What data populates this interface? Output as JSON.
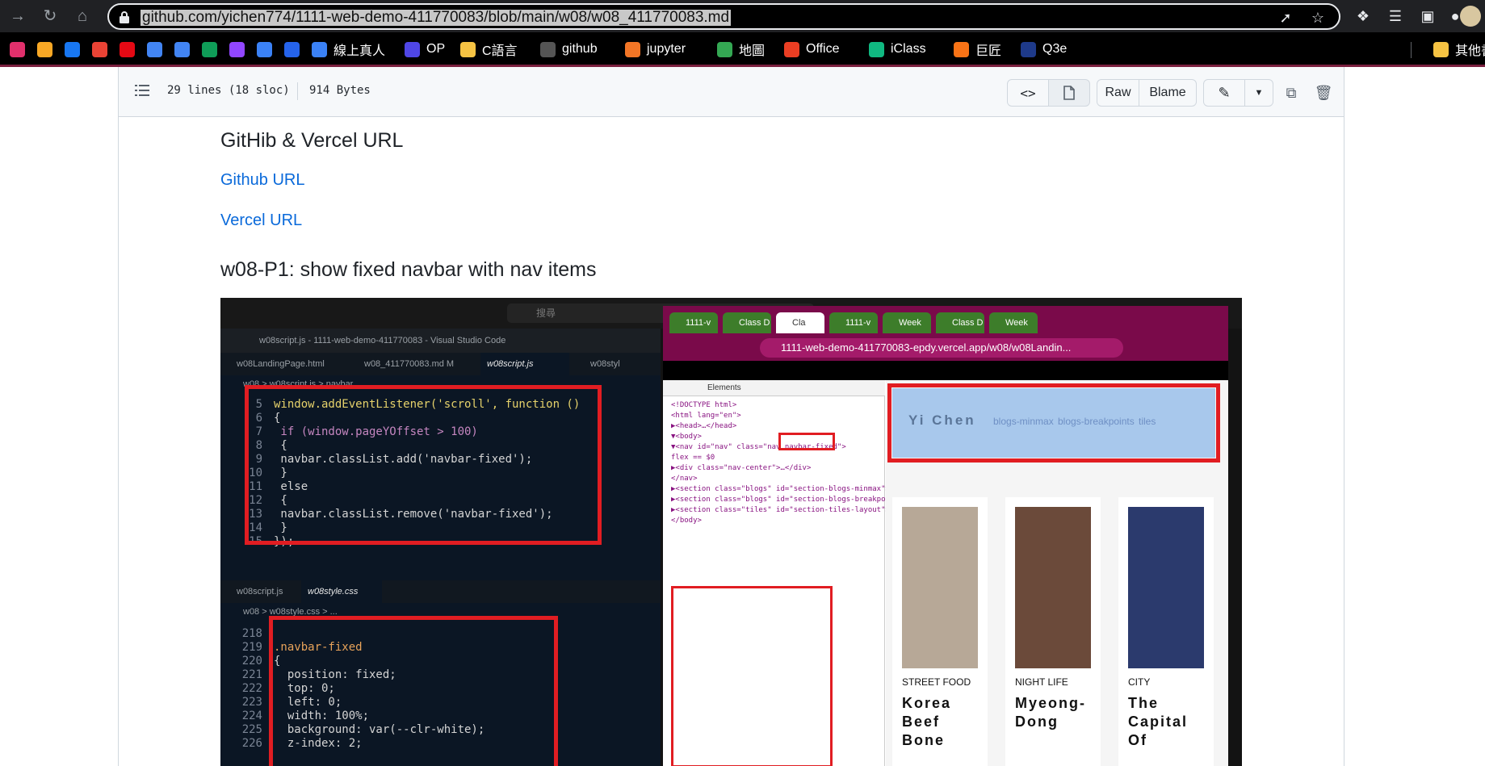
{
  "browser": {
    "url": "github.com/yichen774/1111-web-demo-411770083/blob/main/w08/w08_411770083.md",
    "bookmarks": [
      {
        "label": "",
        "icon": "instagram-icon",
        "color": "#e1306c"
      },
      {
        "label": "",
        "icon": "infinity-icon",
        "color": "#f9a825"
      },
      {
        "label": "",
        "icon": "facebook-icon",
        "color": "#1877f2"
      },
      {
        "label": "",
        "icon": "gmail-icon",
        "color": "#ea4335"
      },
      {
        "label": "",
        "icon": "netflix-icon",
        "color": "#e50914"
      },
      {
        "label": "",
        "icon": "docs-icon",
        "color": "#4285f4"
      },
      {
        "label": "",
        "icon": "translate-icon",
        "color": "#4285f4"
      },
      {
        "label": "",
        "icon": "drive-icon",
        "color": "#0f9d58"
      },
      {
        "label": "",
        "icon": "twitch-icon",
        "color": "#9146ff"
      },
      {
        "label": "",
        "icon": "app-icon",
        "color": "#3b82f6"
      },
      {
        "label": "",
        "icon": "dragon-icon",
        "color": "#2563eb"
      },
      {
        "label": "線上真人",
        "icon": "cloud-icon",
        "color": "#3b82f6"
      },
      {
        "label": "OP",
        "icon": "op-icon",
        "color": "#4f46e5"
      },
      {
        "label": "C語言",
        "icon": "folder-icon",
        "color": "#f6c343"
      },
      {
        "label": "github",
        "icon": "github-icon",
        "color": "#555555"
      },
      {
        "label": "jupyter",
        "icon": "jupyter-icon",
        "color": "#f37626"
      },
      {
        "label": "地圖",
        "icon": "maps-icon",
        "color": "#34a853"
      },
      {
        "label": "Office",
        "icon": "office-icon",
        "color": "#ea3e23"
      },
      {
        "label": "iClass",
        "icon": "iclass-icon",
        "color": "#10b981"
      },
      {
        "label": "巨匠",
        "icon": "jujiang-icon",
        "color": "#f97316"
      },
      {
        "label": "Q3e",
        "icon": "q3e-icon",
        "color": "#1e3a8a"
      }
    ],
    "other_bookmarks": "其他書"
  },
  "file_header": {
    "lines": "29 lines (18 sloc)",
    "size": "914 Bytes",
    "raw": "Raw",
    "blame": "Blame"
  },
  "markdown": {
    "h_urls": "GitHib & Vercel URL",
    "link_github": "Github URL",
    "link_vercel": "Vercel URL",
    "h_p1": "w08-P1: show fixed navbar with nav items"
  },
  "screenshot": {
    "search": "搜尋",
    "vs_title": "w08script.js - 1111-web-demo-411770083 - Visual Studio Code",
    "vs_tabs": [
      "w08LandingPage.html",
      "w08_411770083.md  M",
      "w08script.js",
      "w08styl"
    ],
    "vs_crumb": "w08 > w08script.js > navbar",
    "code1": [
      {
        "n": "5",
        "t": "window.addEventListener('scroll', function ()"
      },
      {
        "n": "6",
        "t": "{"
      },
      {
        "n": "7",
        "t": " if (window.pageYOffset > 100)"
      },
      {
        "n": "8",
        "t": " {"
      },
      {
        "n": "9",
        "t": " navbar.classList.add('navbar-fixed');"
      },
      {
        "n": "10",
        "t": " }"
      },
      {
        "n": "11",
        "t": " else"
      },
      {
        "n": "12",
        "t": " {"
      },
      {
        "n": "13",
        "t": " navbar.classList.remove('navbar-fixed');"
      },
      {
        "n": "14",
        "t": " }"
      },
      {
        "n": "15",
        "t": "});"
      }
    ],
    "vs2_tabs": [
      "w08script.js",
      "w08style.css"
    ],
    "vs2_crumb": "w08 > w08style.css > ...",
    "code2": [
      {
        "n": "218",
        "t": ""
      },
      {
        "n": "219",
        "t": ".navbar-fixed"
      },
      {
        "n": "220",
        "t": "{"
      },
      {
        "n": "221",
        "t": "  position: fixed;"
      },
      {
        "n": "222",
        "t": "  top: 0;"
      },
      {
        "n": "223",
        "t": "  left: 0;"
      },
      {
        "n": "224",
        "t": "  width: 100%;"
      },
      {
        "n": "225",
        "t": "  background: var(--clr-white);"
      },
      {
        "n": "226",
        "t": "  z-index: 2;"
      }
    ],
    "mb_tabs": [
      "1111-v",
      "Class D",
      "Cla",
      "1111-v",
      "Week",
      "Class D",
      "Week"
    ],
    "mb_url": "1111-web-demo-411770083-epdy.vercel.app/w08/w08Landin...",
    "devtools": [
      "<!DOCTYPE html>",
      "<html lang=\"en\">",
      "  ▶<head>…</head>",
      "  ▼<body>",
      "   ▼<nav id=\"nav\" class=\"nav navbar-fixed\">",
      "      flex  == $0",
      "     ▶<div class=\"nav-center\">…</div>",
      "     </nav>",
      "    ▶<section class=\"blogs\" id=\"section-blogs-minmax\">…</section>",
      "    ▶<section class=\"blogs\" id=\"section-blogs-breakpoints\">…</section>",
      "    ▶<section class=\"tiles\" id=\"section-tiles-layout\">…</section>",
      "   </body>"
    ],
    "site_brand": "Yi Chen",
    "site_links": [
      "blogs-minmax",
      "blogs-breakpoints",
      "tiles"
    ],
    "cards": [
      {
        "cat": "STREET FOOD",
        "title": "Korea\nBeef\nBone",
        "color": "#b7a897"
      },
      {
        "cat": "NIGHT LIFE",
        "title": "Myeong-\nDong",
        "color": "#6b4a3a"
      },
      {
        "cat": "CITY",
        "title": "The\nCapital\nOf",
        "color": "#2b3a6d"
      }
    ]
  }
}
